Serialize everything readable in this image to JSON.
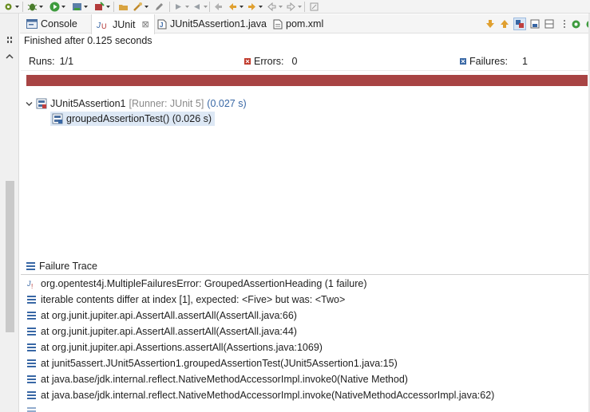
{
  "tabs": [
    {
      "label": "Console",
      "icon": "console-icon"
    },
    {
      "label": "JUnit",
      "icon": "junit-icon",
      "active": true
    },
    {
      "label": "JUnit5Assertion1.java",
      "icon": "java-file-icon"
    },
    {
      "label": "pom.xml",
      "icon": "xml-file-icon"
    }
  ],
  "status": "Finished after 0.125 seconds",
  "counters": {
    "runs_label": "Runs:",
    "runs_value": "1/1",
    "errors_label": "Errors:",
    "errors_value": "0",
    "failures_label": "Failures:",
    "failures_value": "1"
  },
  "progress": {
    "fraction": 1.0,
    "color": "#a84444"
  },
  "tree": {
    "suite_name": "JUnit5Assertion1",
    "suite_runner": "[Runner: JUnit 5]",
    "suite_time": "(0.027 s)",
    "test_label": "groupedAssertionTest() (0.026 s)"
  },
  "trace": {
    "header": "Failure Trace",
    "lines": [
      "org.opentest4j.MultipleFailuresError: GroupedAssertionHeading (1 failure)",
      "iterable contents differ at index [1], expected: <Five> but was: <Two>",
      "at org.junit.jupiter.api.AssertAll.assertAll(AssertAll.java:66)",
      "at org.junit.jupiter.api.AssertAll.assertAll(AssertAll.java:44)",
      "at org.junit.jupiter.api.Assertions.assertAll(Assertions.java:1069)",
      "at junit5assert.JUnit5Assertion1.groupedAssertionTest(JUnit5Assertion1.java:15)",
      "at java.base/jdk.internal.reflect.NativeMethodAccessorImpl.invoke0(Native Method)",
      "at java.base/jdk.internal.reflect.NativeMethodAccessorImpl.invoke(NativeMethodAccessorImpl.java:62)"
    ]
  },
  "colors": {
    "accent": "#3867a5",
    "failure_bar": "#a84444",
    "error_icon": "#c0392b"
  }
}
